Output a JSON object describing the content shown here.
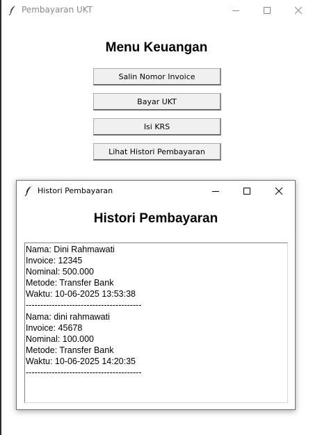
{
  "main_window": {
    "title": "Pembayaran UKT",
    "heading": "Menu Keuangan",
    "buttons": [
      {
        "label": "Salin Nomor Invoice"
      },
      {
        "label": "Bayar UKT"
      },
      {
        "label": "Isi KRS"
      },
      {
        "label": "Lihat Histori Pembayaran"
      }
    ]
  },
  "history_window": {
    "title": "Histori Pembayaran",
    "heading": "Histori Pembayaran",
    "lines": [
      "Nama: Dini Rahmawati",
      "Invoice: 12345",
      "Nominal: 500.000",
      "Metode: Transfer Bank",
      "Waktu: 10-06-2025 13:53:38",
      "----------------------------------------",
      "Nama: dini rahmawati",
      "Invoice: 45678",
      "Nominal: 100.000",
      "Metode: Transfer Bank",
      "Waktu: 10-06-2025 14:20:35",
      "----------------------------------------"
    ]
  }
}
